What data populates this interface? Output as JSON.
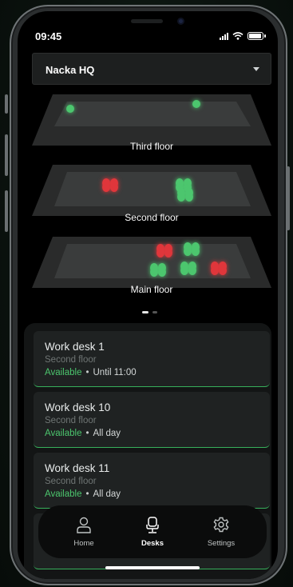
{
  "status_bar": {
    "time": "09:45",
    "battery_level": 0.95
  },
  "location_select": {
    "value": "Nacka HQ"
  },
  "floors": [
    {
      "label": "Third floor",
      "desks": [
        {
          "status": "available"
        },
        {
          "status": "available"
        }
      ]
    },
    {
      "label": "Second floor",
      "desks": [
        {
          "status": "occupied"
        },
        {
          "status": "available"
        },
        {
          "status": "available"
        }
      ]
    },
    {
      "label": "Main floor",
      "desks": [
        {
          "status": "occupied"
        },
        {
          "status": "available"
        },
        {
          "status": "available"
        },
        {
          "status": "available"
        },
        {
          "status": "occupied"
        }
      ]
    }
  ],
  "pager": {
    "active_index": 0,
    "count": 2
  },
  "desks": [
    {
      "name": "Work desk 1",
      "floor": "Second floor",
      "status": "Available",
      "separator": "•",
      "time": "Until 11:00"
    },
    {
      "name": "Work desk 10",
      "floor": "Second floor",
      "status": "Available",
      "separator": "•",
      "time": "All day"
    },
    {
      "name": "Work desk 11",
      "floor": "Second floor",
      "status": "Available",
      "separator": "•",
      "time": "All day"
    }
  ],
  "tabbar": {
    "tabs": [
      {
        "label": "Home",
        "icon": "person-icon",
        "active": false
      },
      {
        "label": "Desks",
        "icon": "chair-icon",
        "active": true
      },
      {
        "label": "Settings",
        "icon": "gear-icon",
        "active": false
      }
    ]
  },
  "colors": {
    "available": "#4cc66e",
    "occupied": "#e0363b",
    "accent": "#37b05b",
    "background": "#000000"
  }
}
